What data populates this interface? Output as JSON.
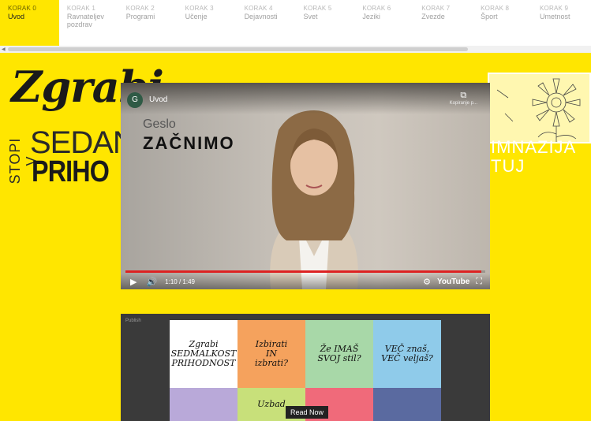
{
  "nav": {
    "items": [
      {
        "step": "KORAK 0",
        "label": "Uvod",
        "active": true
      },
      {
        "step": "KORAK 1",
        "label": "Ravnateljev\npozdrav",
        "active": false
      },
      {
        "step": "KORAK 2",
        "label": "Programi",
        "active": false
      },
      {
        "step": "KORAK 3",
        "label": "Učenje",
        "active": false
      },
      {
        "step": "KORAK 4",
        "label": "Dejavnosti",
        "active": false
      },
      {
        "step": "KORAK 5",
        "label": "Svet",
        "active": false
      },
      {
        "step": "KORAK 6",
        "label": "Jeziki",
        "active": false
      },
      {
        "step": "KORAK 7",
        "label": "Zvezde",
        "active": false
      },
      {
        "step": "KORAK 8",
        "label": "Šport",
        "active": false
      },
      {
        "step": "KORAK 9",
        "label": "Umetnost",
        "active": false
      }
    ]
  },
  "hero": {
    "script": "Zgrabi",
    "stopi": "STOPI V",
    "line1": "SEDAN",
    "line2": "PRIHO",
    "school": "IMNAZIJA\nTUJ"
  },
  "video": {
    "avatar_letter": "G",
    "title": "Uvod",
    "share_label": "Kopiranje p...",
    "geslo": "Geslo",
    "headline": "ZAČNIMO",
    "time": "1:10 / 1:49",
    "progress": 0.99,
    "youtube": "YouTube"
  },
  "flipbook": {
    "header": "Publish",
    "read_now": "Read Now",
    "tiles": [
      {
        "text": "Zgrabi\nSEDMALKOST\nPRIHODNOST",
        "color": "#ffffff"
      },
      {
        "text": "Izbirati\nIN\nizbrati?",
        "color": "#f5a25d"
      },
      {
        "text": "Že IMAŠ\nSVOJ stil?",
        "color": "#a8d8a8"
      },
      {
        "text": "VEČ znaš,\nVEČ veljaš?",
        "color": "#8fcbea"
      },
      {
        "text": "",
        "color": "#b9a9d9"
      },
      {
        "text": "Uzbad",
        "color": "#c8e07a"
      },
      {
        "text": "",
        "color": "#f06a7a"
      },
      {
        "text": "",
        "color": "#5a6aa0"
      }
    ]
  },
  "colors": {
    "brand_yellow": "#ffe600",
    "progress_red": "#dd2222"
  }
}
